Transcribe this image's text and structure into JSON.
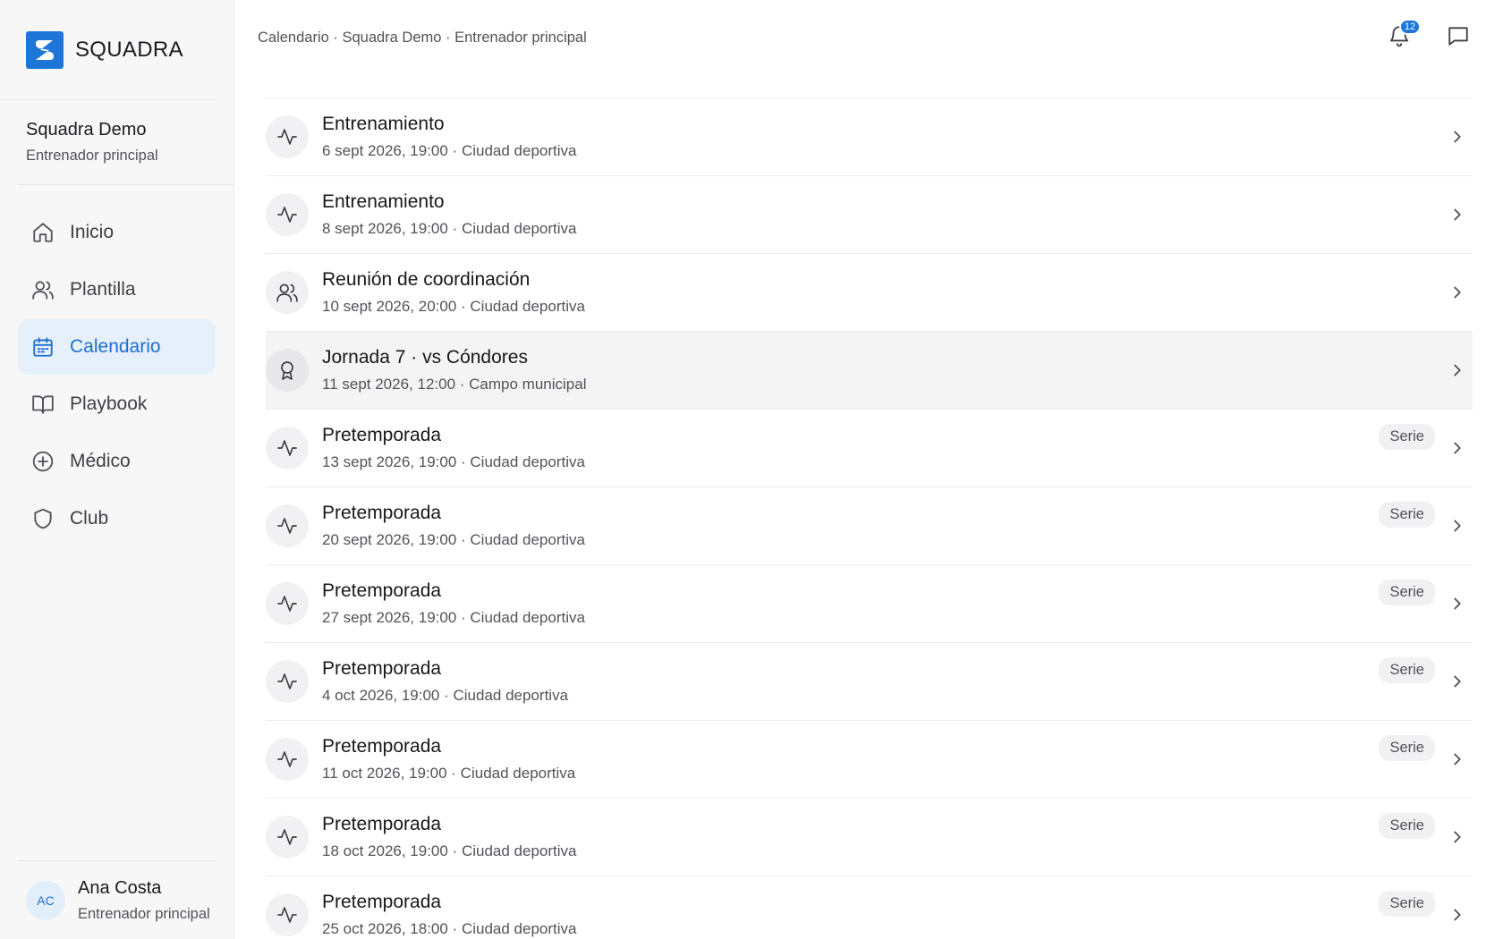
{
  "brand": {
    "name": "SQUADRA"
  },
  "team": {
    "name": "Squadra Demo",
    "role": "Entrenador principal"
  },
  "nav": [
    {
      "label": "Inicio",
      "icon": "home-icon",
      "active": false
    },
    {
      "label": "Plantilla",
      "icon": "users-icon",
      "active": false
    },
    {
      "label": "Calendario",
      "icon": "calendar-icon",
      "active": true
    },
    {
      "label": "Playbook",
      "icon": "book-icon",
      "active": false
    },
    {
      "label": "Médico",
      "icon": "plus-circle-icon",
      "active": false
    },
    {
      "label": "Club",
      "icon": "shield-icon",
      "active": false
    }
  ],
  "user": {
    "initials": "AC",
    "name": "Ana Costa",
    "role": "Entrenador principal"
  },
  "header": {
    "breadcrumb": "Calendario · Squadra Demo · Entrenador principal",
    "notifications_count": "12"
  },
  "events": [
    {
      "title": "Entrenamiento",
      "subtitle": "6 sept 2026, 19:00 · Ciudad deportiva",
      "icon": "activity-icon",
      "badge": ""
    },
    {
      "title": "Entrenamiento",
      "subtitle": "8 sept 2026, 19:00 · Ciudad deportiva",
      "icon": "activity-icon",
      "badge": ""
    },
    {
      "title": "Reunión de coordinación",
      "subtitle": "10 sept 2026, 20:00 · Ciudad deportiva",
      "icon": "users-icon",
      "badge": ""
    },
    {
      "title": "Jornada 7 · vs Cóndores",
      "subtitle": "11 sept 2026, 12:00 · Campo municipal",
      "icon": "award-icon",
      "badge": "",
      "hover": true
    },
    {
      "title": "Pretemporada",
      "subtitle": "13 sept 2026, 19:00 · Ciudad deportiva",
      "icon": "activity-icon",
      "badge": "Serie"
    },
    {
      "title": "Pretemporada",
      "subtitle": "20 sept 2026, 19:00 · Ciudad deportiva",
      "icon": "activity-icon",
      "badge": "Serie"
    },
    {
      "title": "Pretemporada",
      "subtitle": "27 sept 2026, 19:00 · Ciudad deportiva",
      "icon": "activity-icon",
      "badge": "Serie"
    },
    {
      "title": "Pretemporada",
      "subtitle": "4 oct 2026, 19:00 · Ciudad deportiva",
      "icon": "activity-icon",
      "badge": "Serie"
    },
    {
      "title": "Pretemporada",
      "subtitle": "11 oct 2026, 19:00 · Ciudad deportiva",
      "icon": "activity-icon",
      "badge": "Serie"
    },
    {
      "title": "Pretemporada",
      "subtitle": "18 oct 2026, 19:00 · Ciudad deportiva",
      "icon": "activity-icon",
      "badge": "Serie"
    },
    {
      "title": "Pretemporada",
      "subtitle": "25 oct 2026, 18:00 · Ciudad deportiva",
      "icon": "activity-icon",
      "badge": "Serie"
    }
  ]
}
